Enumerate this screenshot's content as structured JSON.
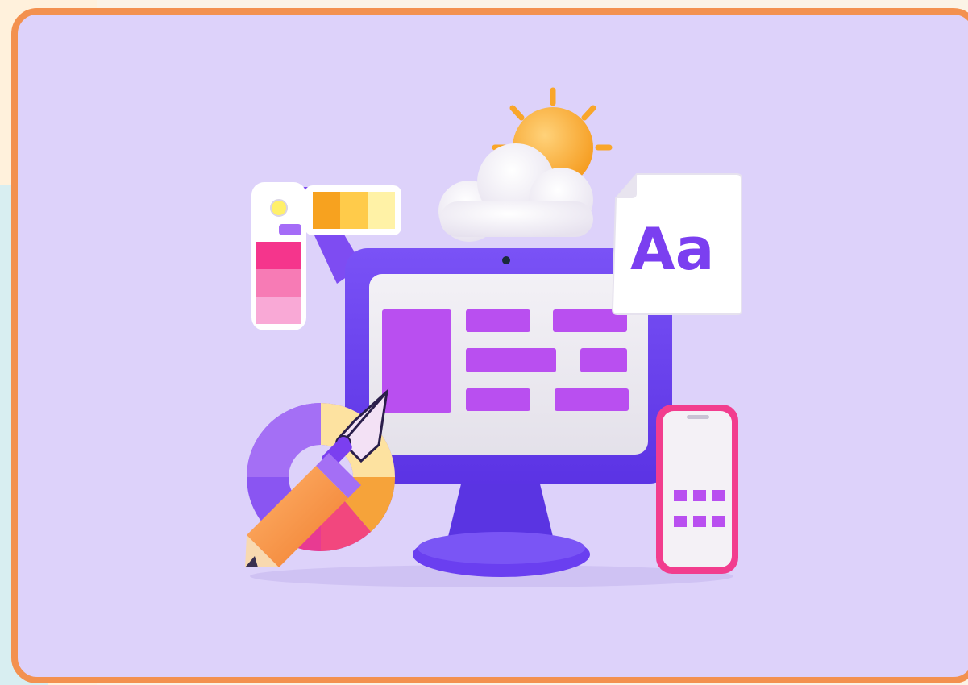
{
  "illustration": {
    "font_card_text": "Aa"
  },
  "colors": {
    "frame_border": "#f3914f",
    "panel_background": "#ddd2fa",
    "monitor_body": "#6a3ff0",
    "content_blocks": "#b94ff0",
    "sun": "#f9a62a",
    "phone_border": "#f23d8e"
  }
}
